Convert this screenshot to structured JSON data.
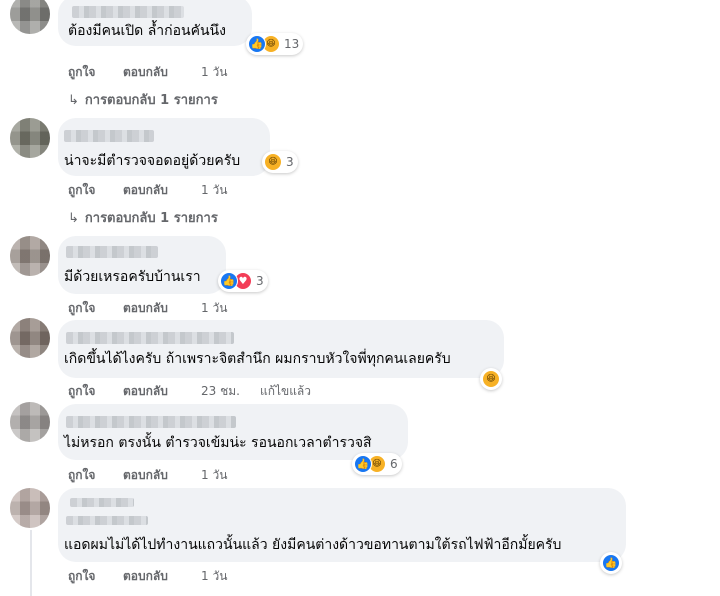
{
  "actions": {
    "like": "ถูกใจ",
    "reply": "ตอบกลับ",
    "edited": "แก้ไขแล้ว"
  },
  "icons": {
    "like": "thumbs-up-icon",
    "haha": "laughing-face-icon",
    "love": "heart-icon",
    "reply_arrow": "reply-arrow-icon"
  },
  "colors": {
    "like_blue": "#1877f2",
    "haha_yellow": "#f7b125",
    "love_red": "#f33e58",
    "bubble_bg": "#f0f2f5",
    "meta_gray": "#65676b"
  },
  "comments": [
    {
      "text": "ต้องมีคนเปิด ล้ำก่อนคันนึง",
      "reaction_count": "13",
      "time": "1 วัน",
      "replies_label": "การตอบกลับ 1 รายการ"
    },
    {
      "text": "น่าจะมีตำรวจจอดอยู่ด้วยครับ",
      "reaction_count": "3",
      "time": "1 วัน",
      "replies_label": "การตอบกลับ 1 รายการ"
    },
    {
      "text": "มีด้วยเหรอครับบ้านเรา",
      "reaction_count": "3",
      "time": "1 วัน"
    },
    {
      "text": "เกิดขึ้นได้ไงครับ ถ้าเพราะจิตสำนึก ผมกราบหัวใจพี่ทุกคนเลยครับ",
      "time": "23 ชม."
    },
    {
      "text": "ไม่หรอก ตรงนั้น ตำรวจเข้มน่ะ รอนอกเวลาตำรวจสิ",
      "reaction_count": "6",
      "time": "1 วัน"
    },
    {
      "text": "แอดผมไม่ได้ไปทำงานแถวนั้นแล้ว ยังมีคนต่างด้าวขอทานตามใต้รถไฟฟ้าอีกมั้ยครับ",
      "time": "1 วัน"
    }
  ]
}
